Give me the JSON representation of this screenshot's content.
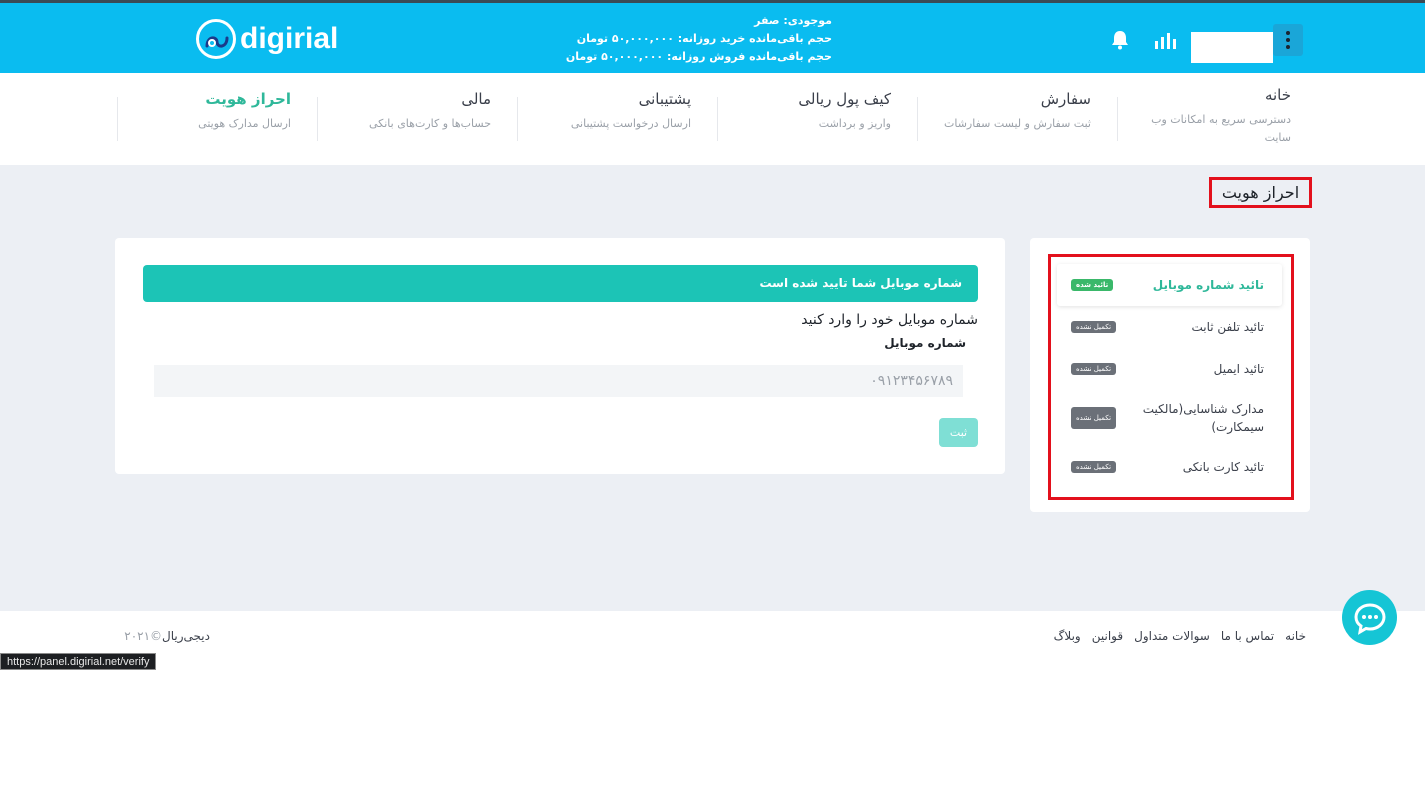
{
  "header": {
    "logo_text": "digirial",
    "balance_line": "موجودی: صفر",
    "daily_buy_line": "حجم باقی‌مانده خرید روزانه: ۵۰,۰۰۰,۰۰۰ تومان",
    "daily_sell_line": "حجم باقی‌مانده فروش روزانه: ۵۰,۰۰۰,۰۰۰ تومان",
    "icons": [
      "bell-icon",
      "bar-chart-icon",
      "kebab-menu-icon"
    ],
    "accent_color": "#0abcf0"
  },
  "nav": {
    "items": [
      {
        "title": "خانه",
        "subtitle": "دسترسی سریع به امکانات وب سایت"
      },
      {
        "title": "سفارش",
        "subtitle": "ثبت سفارش و لیست سفارشات"
      },
      {
        "title": "کیف پول ریالی",
        "subtitle": "واریز و برداشت"
      },
      {
        "title": "پشتیبانی",
        "subtitle": "ارسال درخواست پشتیبانی"
      },
      {
        "title": "مالی",
        "subtitle": "حساب‌ها و کارت‌های بانکی"
      },
      {
        "title": "احراز هویت",
        "subtitle": "ارسال مدارک هویتی"
      }
    ],
    "active_color": "#2fb89a"
  },
  "page": {
    "title": "احراز هویت"
  },
  "steps": [
    {
      "label": "تائید شماره موبایل",
      "status": "تائید شده"
    },
    {
      "label": "تائید تلفن ثابت",
      "status": "تکمیل نشده"
    },
    {
      "label": "تائید ایمیل",
      "status": "تکمیل نشده"
    },
    {
      "label": "مدارک شناسایی(مالکیت سیمکارت)",
      "status": "تکمیل نشده"
    },
    {
      "label": "تائید کارت بانکی",
      "status": "تکمیل نشده"
    }
  ],
  "form": {
    "alert": "شماره موبایل شما تایید شده است",
    "prompt": "شماره موبایل خود را وارد کنید",
    "field_label": "شماره موبایل",
    "mobile_value": "۰۹۱۲۳۴۵۶۷۸۹",
    "submit_label": "ثبت"
  },
  "footer": {
    "links": [
      "خانه",
      "تماس با ما",
      "سوالات متداول",
      "قوانین",
      "وبلاگ"
    ],
    "copyright_year": "©۲۰۲۱",
    "copyright_brand": "دیجی‌ریال"
  },
  "status_bar": {
    "url": "https://panel.digirial.net/verify"
  }
}
